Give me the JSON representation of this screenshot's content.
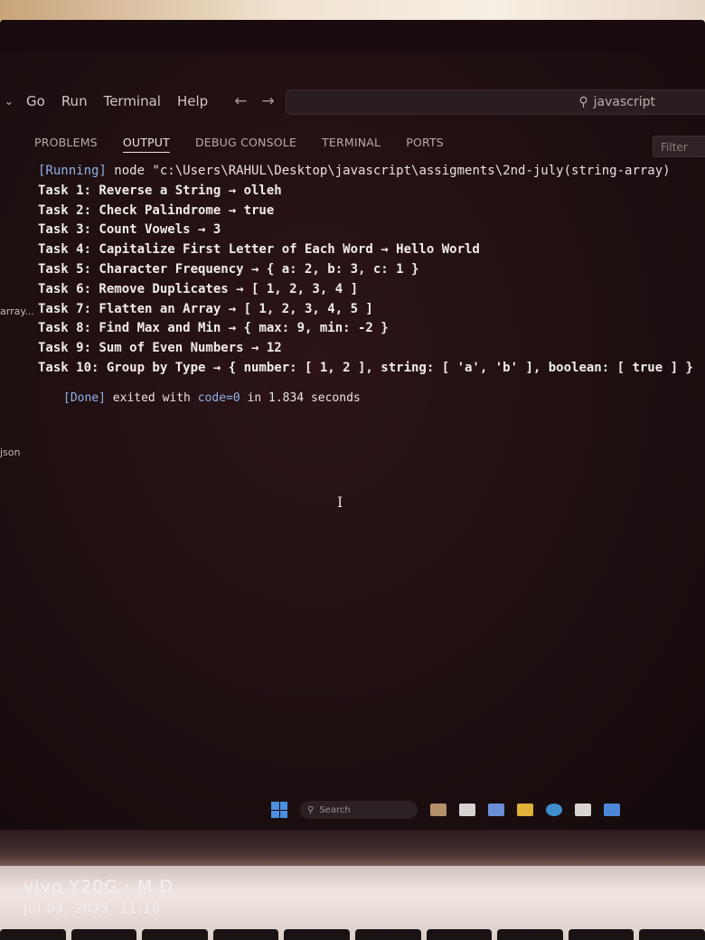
{
  "menu": {
    "items": [
      "Go",
      "Run",
      "Terminal",
      "Help"
    ],
    "back_icon": "arrow-left-icon",
    "forward_icon": "arrow-right-icon"
  },
  "command_center": {
    "value": "javascript",
    "icon": "search-icon"
  },
  "panel": {
    "tabs": [
      "PROBLEMS",
      "OUTPUT",
      "DEBUG CONSOLE",
      "TERMINAL",
      "PORTS"
    ],
    "active_tab": "OUTPUT",
    "filter_placeholder": "Filter"
  },
  "sidebar": {
    "items": [
      "array...",
      "json"
    ]
  },
  "output": {
    "running_tag": "[Running]",
    "running_cmd": "node \"c:\\Users\\RAHUL\\Desktop\\javascript\\assigments\\2nd-july(string-array)",
    "lines": [
      "Task 1: Reverse a String → olleh",
      "Task 2: Check Palindrome → true",
      "Task 3: Count Vowels → 3",
      "Task 4: Capitalize First Letter of Each Word → Hello World",
      "Task 5: Character Frequency → { a: 2, b: 3, c: 1 }",
      "Task 6: Remove Duplicates → [ 1, 2, 3, 4 ]",
      "Task 7: Flatten an Array → [ 1, 2, 3, 4, 5 ]",
      "Task 8: Find Max and Min → { max: 9, min: -2 }",
      "Task 9: Sum of Even Numbers → 12",
      "Task 10: Group by Type → { number: [ 1, 2 ], string: [ 'a', 'b' ], boolean: [ true ] }"
    ],
    "done_tag": "[Done]",
    "done_pre": " exited with ",
    "done_code": "code=0",
    "done_post": " in 1.834 seconds"
  },
  "taskbar": {
    "search_label": "Search"
  },
  "watermark": {
    "device": "vivo Y20G · M D",
    "datetime": "Jul 03, 2025, 11:18"
  },
  "colors": {
    "accent_blue": "#8fb0e6",
    "screen_bg": "#1e0f11",
    "text": "#f1ecea"
  }
}
